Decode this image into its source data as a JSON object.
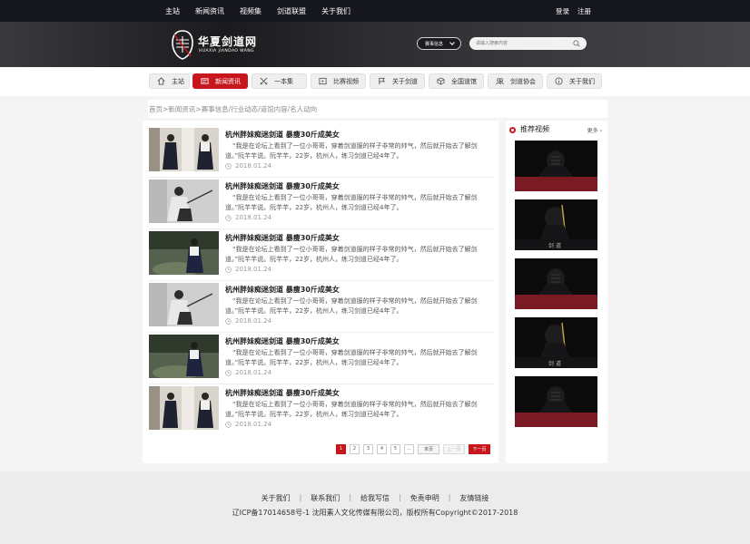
{
  "topbar": {
    "nav": [
      "主站",
      "新闻资讯",
      "视频集",
      "剑道联盟",
      "关于我们"
    ],
    "login": "登录",
    "register": "注册"
  },
  "header": {
    "logo_cn": "华夏剑道网",
    "logo_en": "HUAXIA JIANDAO WANG",
    "event_select": "赛事信息",
    "search_placeholder": "请输入搜索内容"
  },
  "mainnav": [
    {
      "label": "主站",
      "icon": "home-icon"
    },
    {
      "label": "新闻资讯",
      "icon": "news-icon",
      "active": true
    },
    {
      "label": "一本集",
      "icon": "crossed-swords-icon"
    },
    {
      "label": "比赛视频",
      "icon": "video-play-icon"
    },
    {
      "label": "关于剑道",
      "icon": "flag-icon"
    },
    {
      "label": "全国道馆",
      "icon": "cube-icon"
    },
    {
      "label": "剑道协会",
      "icon": "group-icon"
    },
    {
      "label": "关于我们",
      "icon": "info-icon"
    }
  ],
  "breadcrumb": "首页>新闻资讯>赛事信息/行业动态/道馆内容/名人动向",
  "articles": [
    {
      "title": "杭州胖妹痴迷剑道 暴瘦30斤成美女",
      "desc": "“我是在论坛上看到了一位小哥哥，穿着剑道服的样子非常的帅气，然后就开始去了解剑道。”阮芊芊说。阮芊芊，22岁，杭州人，练习剑道已经4年了。",
      "date": "2018.01.24"
    },
    {
      "title": "杭州胖妹痴迷剑道 暴瘦30斤成美女",
      "desc": "“我是在论坛上看到了一位小哥哥，穿着剑道服的样子非常的帅气，然后就开始去了解剑道。”阮芊芊说。阮芊芊，22岁，杭州人，练习剑道已经4年了。",
      "date": "2018.01.24"
    },
    {
      "title": "杭州胖妹痴迷剑道 暴瘦30斤成美女",
      "desc": "“我是在论坛上看到了一位小哥哥，穿着剑道服的样子非常的帅气，然后就开始去了解剑道。”阮芊芊说。阮芊芊，22岁，杭州人，练习剑道已经4年了。",
      "date": "2018.01.24"
    },
    {
      "title": "杭州胖妹痴迷剑道 暴瘦30斤成美女",
      "desc": "“我是在论坛上看到了一位小哥哥，穿着剑道服的样子非常的帅气，然后就开始去了解剑道。”阮芊芊说。阮芊芊，22岁，杭州人，练习剑道已经4年了。",
      "date": "2018.01.24"
    },
    {
      "title": "杭州胖妹痴迷剑道 暴瘦30斤成美女",
      "desc": "“我是在论坛上看到了一位小哥哥，穿着剑道服的样子非常的帅气，然后就开始去了解剑道。”阮芊芊说。阮芊芊，22岁，杭州人，练习剑道已经4年了。",
      "date": "2018.01.24"
    },
    {
      "title": "杭州胖妹痴迷剑道 暴瘦30斤成美女",
      "desc": "“我是在论坛上看到了一位小哥哥，穿着剑道服的样子非常的帅气，然后就开始去了解剑道。”阮芊芊说。阮芊芊，22岁，杭州人，练习剑道已经4年了。",
      "date": "2018.01.24"
    }
  ],
  "pagination": {
    "pages": [
      "1",
      "2",
      "3",
      "4",
      "5",
      "..."
    ],
    "last": "末页",
    "prev": "上一页",
    "next": "下一页"
  },
  "sidebar": {
    "title": "推荐视频",
    "more": "更多",
    "video_caption": "剑 道"
  },
  "footer": {
    "links": [
      "关于我们",
      "联系我们",
      "给我写信",
      "免责申明",
      "友情链接"
    ],
    "copyright": "辽ICP备17014658号-1 沈阳素人文化传媒有限公司，版权所有Copyright©2017-2018"
  },
  "colors": {
    "accent": "#c8161d",
    "topbar": "#16161e",
    "footer": "#ececec"
  }
}
